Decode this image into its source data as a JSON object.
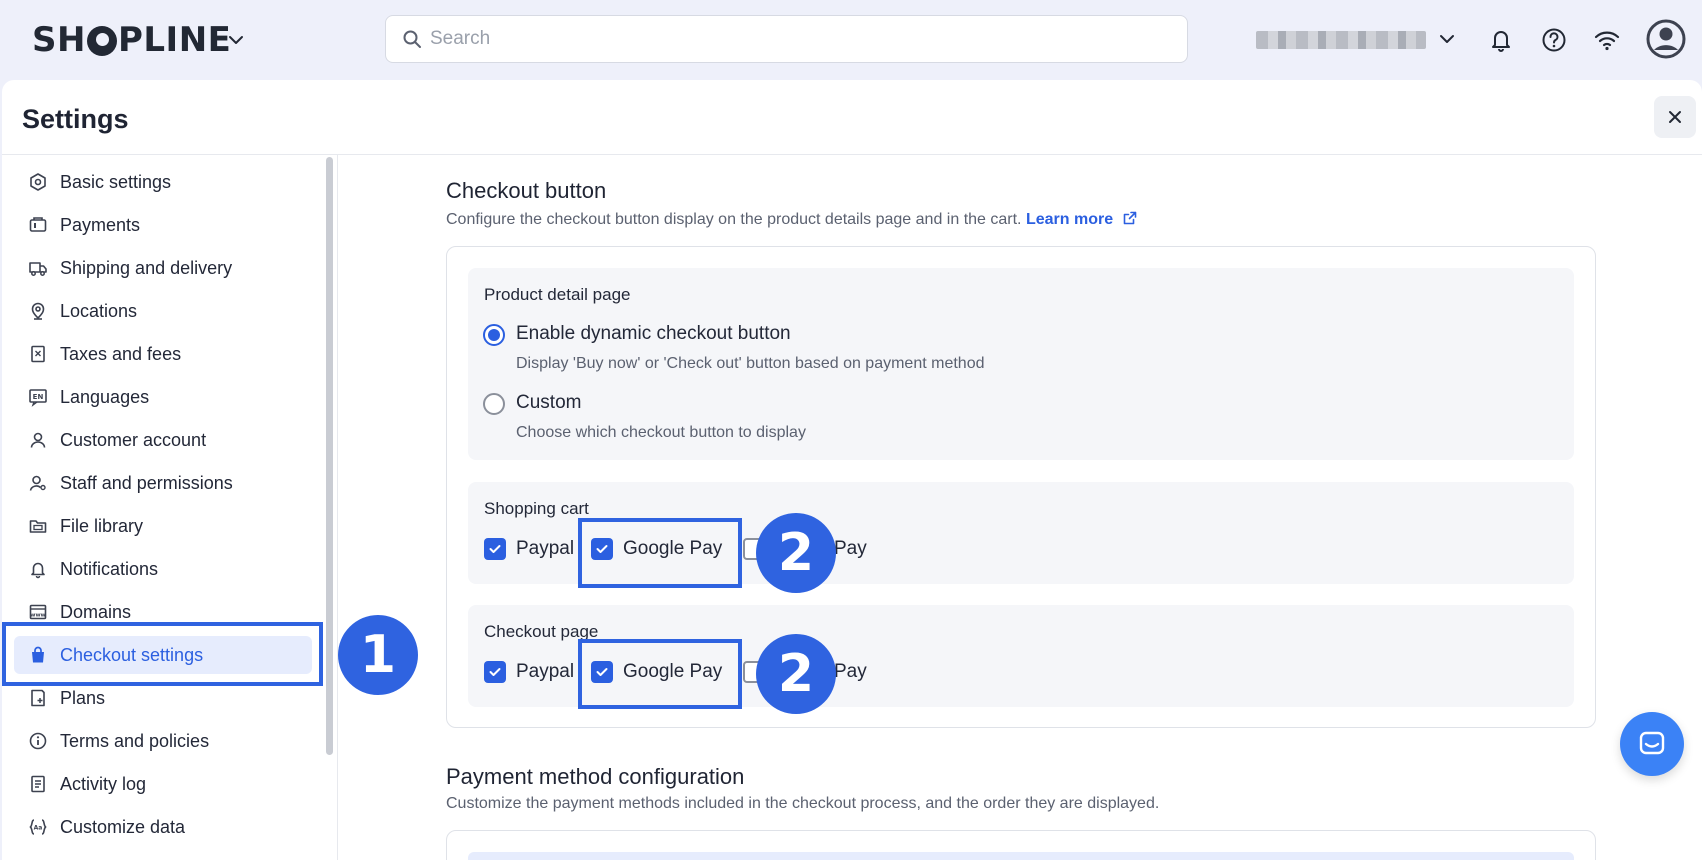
{
  "header": {
    "logo_pre": "SH",
    "logo_post": "PLINE",
    "search_placeholder": "Search"
  },
  "settings": {
    "title": "Settings"
  },
  "sidebar": {
    "items": [
      {
        "label": "Basic settings",
        "icon": "hexagon-settings-icon"
      },
      {
        "label": "Payments",
        "icon": "wallet-icon"
      },
      {
        "label": "Shipping and delivery",
        "icon": "truck-icon"
      },
      {
        "label": "Locations",
        "icon": "location-pin-icon"
      },
      {
        "label": "Taxes and fees",
        "icon": "receipt-icon"
      },
      {
        "label": "Languages",
        "icon": "language-icon"
      },
      {
        "label": "Customer account",
        "icon": "user-icon"
      },
      {
        "label": "Staff and permissions",
        "icon": "staff-icon"
      },
      {
        "label": "File library",
        "icon": "folder-icon"
      },
      {
        "label": "Notifications",
        "icon": "bell-icon"
      },
      {
        "label": "Domains",
        "icon": "domain-icon"
      },
      {
        "label": "Checkout settings",
        "icon": "bag-icon"
      },
      {
        "label": "Plans",
        "icon": "plans-icon"
      },
      {
        "label": "Terms and policies",
        "icon": "info-icon"
      },
      {
        "label": "Activity log",
        "icon": "log-icon"
      },
      {
        "label": "Customize data",
        "icon": "custom-data-icon"
      }
    ],
    "active": "Checkout settings"
  },
  "checkout_button": {
    "title": "Checkout button",
    "description": "Configure the checkout button display on the product details page and in the cart.",
    "learn_more": "Learn more",
    "product_detail": {
      "title": "Product detail page",
      "options": [
        {
          "label": "Enable dynamic checkout button",
          "desc": "Display 'Buy now' or 'Check out' button based on payment method",
          "selected": true
        },
        {
          "label": "Custom",
          "desc": "Choose which checkout button to display",
          "selected": false
        }
      ]
    },
    "shopping_cart": {
      "title": "Shopping cart",
      "paypal": "Paypal",
      "google_pay": "Google Pay",
      "third_suffix": "Pay"
    },
    "checkout_page": {
      "title": "Checkout page",
      "paypal": "Paypal",
      "google_pay": "Google Pay",
      "third_suffix": "Pay"
    }
  },
  "payment_config": {
    "title": "Payment method configuration",
    "description": "Customize the payment methods included in the checkout process, and the order they are displayed."
  },
  "annotations": {
    "badge_1": "1",
    "badge_2": "2",
    "color": "#2f63e0"
  }
}
